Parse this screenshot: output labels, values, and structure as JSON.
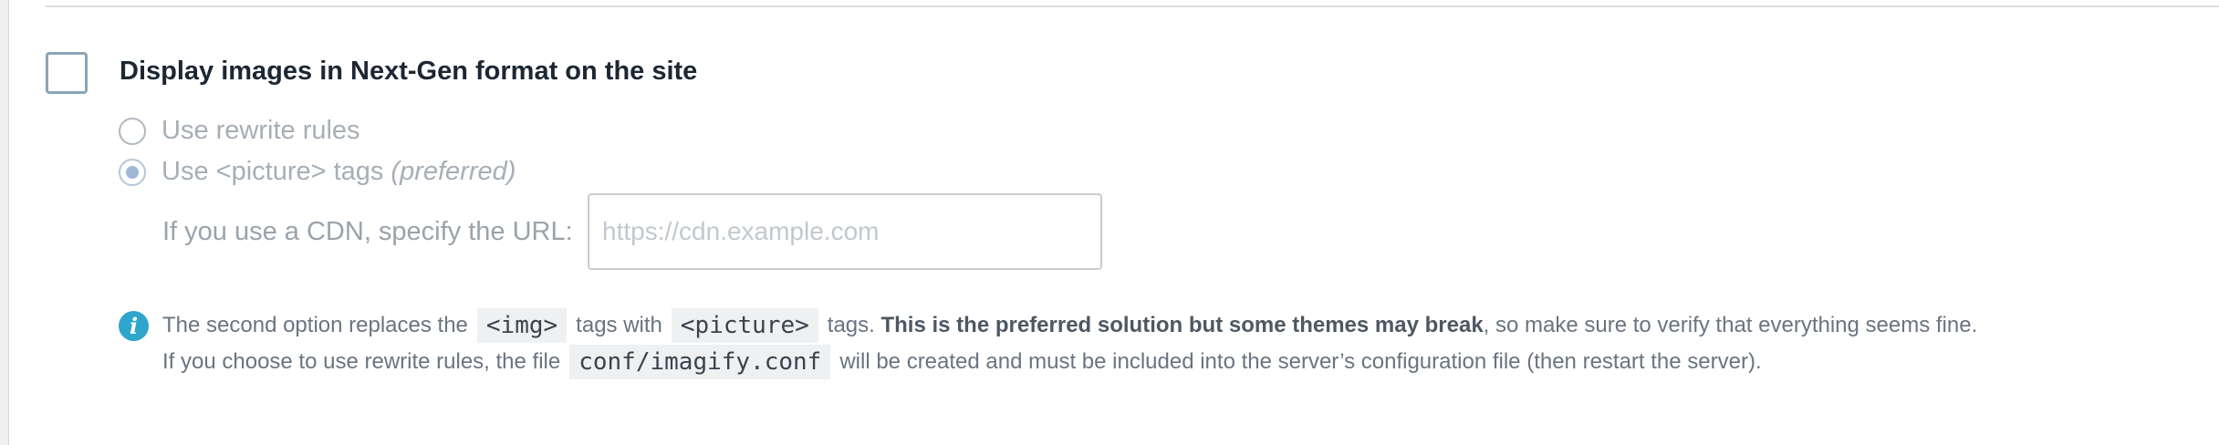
{
  "setting": {
    "main_label": "Display images in Next-Gen format on the site",
    "checked": false
  },
  "options": [
    {
      "label": "Use rewrite rules",
      "suffix": "",
      "selected": false
    },
    {
      "label": "Use <picture> tags",
      "suffix": "(preferred)",
      "selected": true
    }
  ],
  "cdn": {
    "label": "If you use a CDN, specify the URL:",
    "placeholder": "https://cdn.example.com",
    "value": ""
  },
  "note": {
    "line1_a": "The second option replaces the",
    "code1": "<img>",
    "line1_b": "tags with",
    "code2": "<picture>",
    "line1_c": "tags.",
    "line1_bold": "This is the preferred solution but some themes may break",
    "line1_d": ", so make sure to verify that everything seems fine.",
    "line2_a": "If you choose to use rewrite rules, the file",
    "code3": "conf/imagify.conf",
    "line2_b": "will be created and must be included into the server’s configuration file (then restart the server)."
  },
  "colors": {
    "accent_info": "#2ea6cc",
    "radio_selected": "#9fb8d7"
  }
}
